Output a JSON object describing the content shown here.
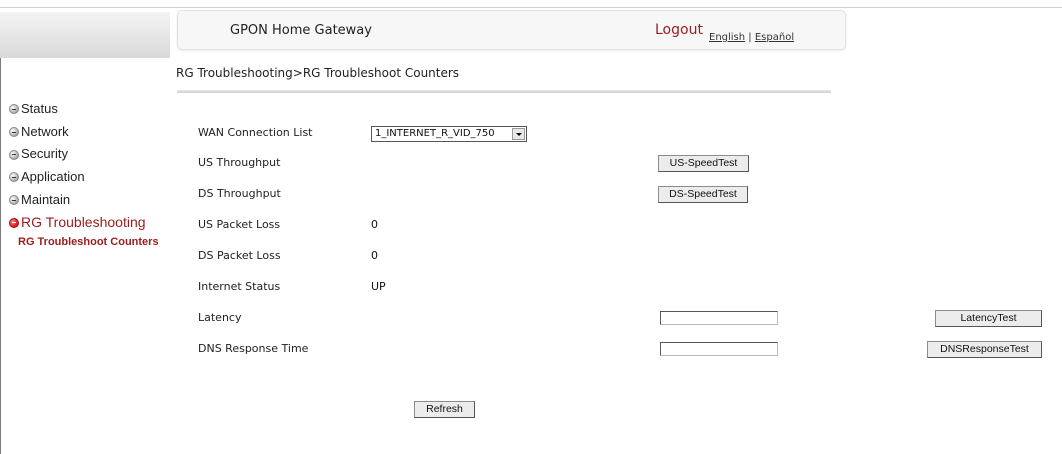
{
  "header": {
    "app_title": "GPON Home Gateway",
    "logout": "Logout",
    "lang_en": "English",
    "lang_sep": "|",
    "lang_es": "Español"
  },
  "sidebar": {
    "items": [
      {
        "label": "Status"
      },
      {
        "label": "Network"
      },
      {
        "label": "Security"
      },
      {
        "label": "Application"
      },
      {
        "label": "Maintain"
      },
      {
        "label": "RG Troubleshooting"
      }
    ],
    "subitem": "RG Troubleshoot Counters"
  },
  "breadcrumb": "RG Troubleshooting>RG Troubleshoot Counters",
  "form": {
    "wan_label": "WAN Connection List",
    "wan_selected": "1_INTERNET_R_VID_750",
    "us_throughput_label": "US Throughput",
    "us_speedtest_button": "US-SpeedTest",
    "ds_throughput_label": "DS Throughput",
    "ds_speedtest_button": "DS-SpeedTest",
    "us_packet_loss_label": "US Packet Loss",
    "us_packet_loss_value": "0",
    "ds_packet_loss_label": "DS Packet Loss",
    "ds_packet_loss_value": "0",
    "internet_status_label": "Internet Status",
    "internet_status_value": "UP",
    "latency_label": "Latency",
    "latency_value": "",
    "latency_button": "LatencyTest",
    "dns_label": "DNS Response Time",
    "dns_value": "",
    "dns_button": "DNSResponseTest",
    "refresh_button": "Refresh"
  },
  "colors": {
    "accent": "#9b1c1c"
  }
}
